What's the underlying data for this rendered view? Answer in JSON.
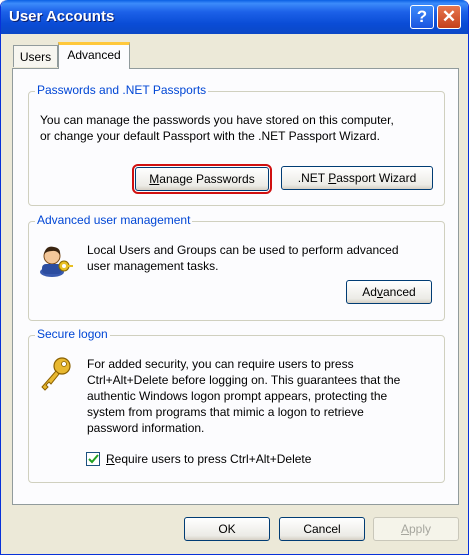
{
  "window": {
    "title": "User Accounts",
    "help_glyph": "?",
    "close_glyph": "✕"
  },
  "tabs": [
    {
      "label": "Users",
      "selected": false
    },
    {
      "label": "Advanced",
      "selected": true
    }
  ],
  "passwords_group": {
    "title": "Passwords and .NET Passports",
    "description_line1": "You can manage the passwords you have stored on this computer,",
    "description_line2": "or change your default Passport with the .NET Passport Wizard.",
    "manage_button_label": "Manage Passwords",
    "manage_button_mnemonic": "M",
    "manage_button_rest": "anage Passwords",
    "wizard_button_prefix": ".NET ",
    "wizard_button_mnemonic": "P",
    "wizard_button_rest": "assport Wizard"
  },
  "advanced_group": {
    "title": "Advanced user management",
    "description_line1": "Local Users and Groups can be used to perform advanced",
    "description_line2": "user management tasks.",
    "advanced_button_prefix": "Ad",
    "advanced_button_mnemonic": "v",
    "advanced_button_rest": "anced",
    "icon": "users-key-icon"
  },
  "secure_group": {
    "title": "Secure logon",
    "description_line1": "For added security, you can require users to press",
    "description_line2": "Ctrl+Alt+Delete before logging on. This guarantees that the",
    "description_line3": "authentic Windows logon prompt appears, protecting the",
    "description_line4": "system from programs that mimic a logon to retrieve",
    "description_line5": "password information.",
    "checkbox_checked": true,
    "checkbox_mnemonic": "R",
    "checkbox_rest": "equire users to press Ctrl+Alt+Delete",
    "icon": "key-icon"
  },
  "footer": {
    "ok_label": "OK",
    "cancel_label": "Cancel",
    "apply_mnemonic": "A",
    "apply_rest": "pply",
    "apply_enabled": false
  },
  "colors": {
    "titlebar": "#0a4cd6",
    "group_title": "#0046d5",
    "highlight_border": "#d01010",
    "tab_accent": "#ffc83c"
  }
}
